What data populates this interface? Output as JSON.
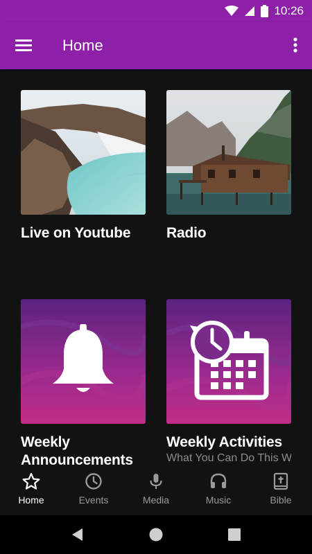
{
  "status": {
    "time": "10:26"
  },
  "appbar": {
    "title": "Home"
  },
  "cards": [
    {
      "label": "Live on Youtube"
    },
    {
      "label": "Radio"
    },
    {
      "label": "Weekly Announcements"
    },
    {
      "label": "Weekly Activities",
      "subtitle": "What You Can Do This Week"
    }
  ],
  "nav": [
    {
      "label": "Home",
      "icon": "star-icon",
      "active": true
    },
    {
      "label": "Events",
      "icon": "clock-icon"
    },
    {
      "label": "Media",
      "icon": "microphone-icon"
    },
    {
      "label": "Music",
      "icon": "headphones-icon"
    },
    {
      "label": "Bible",
      "icon": "bible-icon"
    }
  ],
  "colors": {
    "primary": "#8e1fa8",
    "background": "#121212",
    "inactive_nav": "#9a9a9a"
  }
}
